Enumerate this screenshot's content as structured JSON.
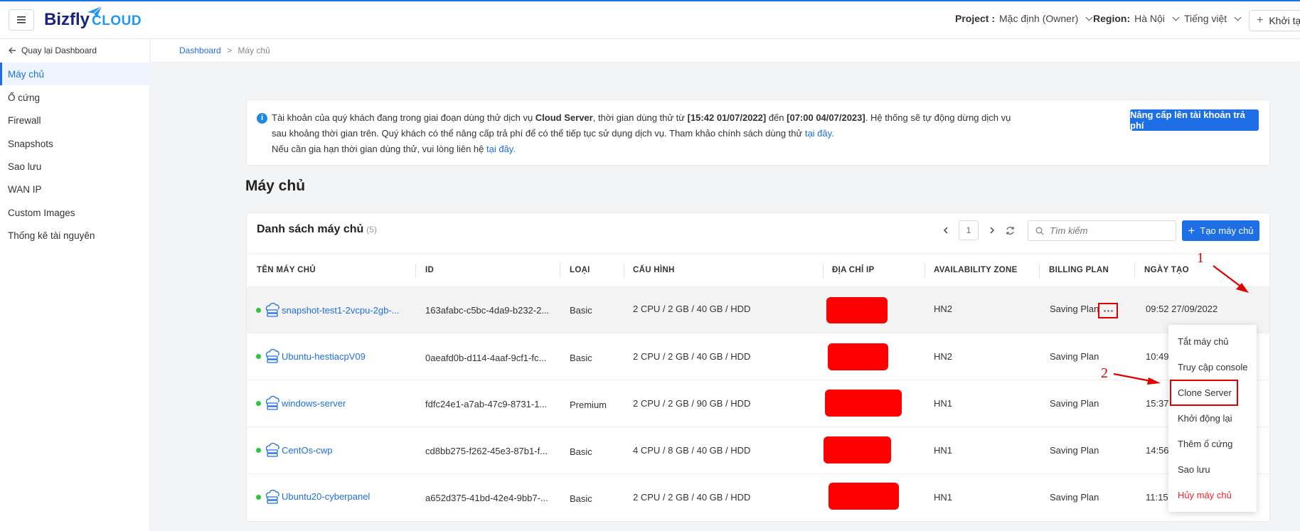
{
  "header": {
    "logo_main": "Bizfly",
    "logo_sub": "CLOUD",
    "project_label": "Project :",
    "project_value": "Mặc định (Owner)",
    "region_label": "Region:",
    "region_value": "Hà Nội",
    "language": "Tiếng việt",
    "create_label": "Khởi tạo"
  },
  "sidebar": {
    "back_label": "Quay lại Dashboard",
    "items": [
      {
        "label": "Máy chủ"
      },
      {
        "label": "Ổ cứng"
      },
      {
        "label": "Firewall"
      },
      {
        "label": "Snapshots"
      },
      {
        "label": "Sao lưu"
      },
      {
        "label": "WAN IP"
      },
      {
        "label": "Custom Images"
      },
      {
        "label": "Thống kê tài nguyên"
      }
    ]
  },
  "breadcrumb": {
    "root": "Dashboard",
    "sep": ">",
    "current": "Máy chủ"
  },
  "notice": {
    "icon": "info-icon",
    "p1": "Tài khoản của quý khách đang trong giai đoạn dùng thử dịch vụ ",
    "service": "Cloud Server",
    "p2": ", thời gian dùng thử từ ",
    "start": "[15:42 01/07/2022]",
    "p3": " đến ",
    "end": "[07:00 04/07/2023]",
    "p4": ". Hệ thống sẽ tự động dừng dịch vụ sau khoảng thời gian trên. Quý khách có thể nâng cấp trả phí để có thể tiếp tục sử dụng dịch vụ. Tham khảo chính sách dùng thử ",
    "link1": "tại đây.",
    "p5": "Nếu cần gia hạn thời gian dùng thử, vui lòng liên hệ ",
    "link2": "tại đây.",
    "upgrade_button": "Nâng cấp lên tài khoản trả phí"
  },
  "page_title": "Máy chủ",
  "list": {
    "title": "Danh sách máy chủ",
    "count": "(5)",
    "page": "1",
    "search_placeholder": "Tìm kiếm",
    "create_button": "Tạo máy chủ",
    "columns": [
      "TÊN MÁY CHỦ",
      "ID",
      "LOẠI",
      "CẤU HÌNH",
      "ĐỊA CHỈ IP",
      "AVAILABILITY ZONE",
      "BILLING PLAN",
      "NGÀY TẠO"
    ],
    "rows": [
      {
        "name": "snapshot-test1-2vcpu-2gb-...",
        "id": "163afabc-c5bc-4da9-b232-2...",
        "type": "Basic",
        "config": "2 CPU / 2 GB / 40 GB / HDD",
        "zone": "HN2",
        "plan": "Saving Plan",
        "created": "09:52 27/09/2022"
      },
      {
        "name": "Ubuntu-hestiacpV09",
        "id": "0aeafd0b-d114-4aaf-9cf1-fc...",
        "type": "Basic",
        "config": "2 CPU / 2 GB / 40 GB / HDD",
        "zone": "HN2",
        "plan": "Saving Plan",
        "created": "10:49"
      },
      {
        "name": "windows-server",
        "id": "fdfc24e1-a7ab-47c9-8731-1...",
        "type": "Premium",
        "config": "2 CPU / 2 GB / 90 GB / HDD",
        "zone": "HN1",
        "plan": "Saving Plan",
        "created": "15:37"
      },
      {
        "name": "CentOs-cwp",
        "id": "cd8bb275-f262-45e3-87b1-f...",
        "type": "Basic",
        "config": "4 CPU / 8 GB / 40 GB / HDD",
        "zone": "HN1",
        "plan": "Saving Plan",
        "created": "14:56"
      },
      {
        "name": "Ubuntu20-cyberpanel",
        "id": "a652d375-41bd-42e4-9bb7-...",
        "type": "Basic",
        "config": "2 CPU / 2 GB / 40 GB / HDD",
        "zone": "HN1",
        "plan": "Saving Plan",
        "created": "11:15"
      }
    ]
  },
  "dropdown": {
    "items": [
      "Tắt máy chủ",
      "Truy cập console",
      "Clone Server",
      "Khởi động lại",
      "Thêm ổ cứng",
      "Sao lưu",
      "Hủy máy chủ"
    ]
  },
  "annotations": {
    "n1": "1",
    "n2": "2"
  },
  "colors": {
    "accent": "#1e6fe5",
    "status_running": "#2ec443",
    "annotation_red": "#e00000",
    "danger": "#f5222d"
  }
}
